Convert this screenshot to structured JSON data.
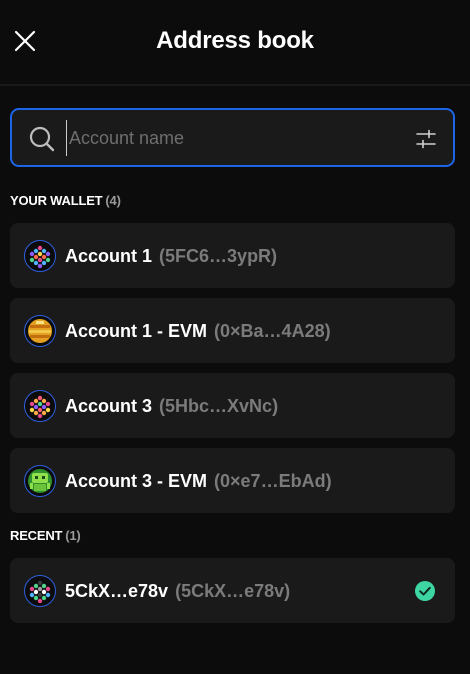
{
  "header": {
    "title": "Address book"
  },
  "search": {
    "placeholder": "Account name"
  },
  "wallet_section": {
    "label": "YOUR WALLET",
    "count": "(4)"
  },
  "recent_section": {
    "label": "RECENT",
    "count": "(1)"
  },
  "wallet_accounts": [
    {
      "name": "Account 1",
      "address": "(5FC6…3ypR)",
      "icon": "polkadot-identicon"
    },
    {
      "name": "Account 1 - EVM",
      "address": "(0×Ba…4A28)",
      "icon": "ethereum-avatar"
    },
    {
      "name": "Account 3",
      "address": "(5Hbc…XvNc)",
      "icon": "polkadot-identicon"
    },
    {
      "name": "Account 3 - EVM",
      "address": "(0×e7…EbAd)",
      "icon": "ethereum-avatar"
    }
  ],
  "recent_accounts": [
    {
      "name": "5CkX…e78v",
      "address": "(5CkX…e78v)",
      "icon": "polkadot-identicon",
      "selected": true
    }
  ],
  "colors": {
    "accent": "#1d64e6",
    "background": "#0c0c0c",
    "item_background": "#1a1a1a",
    "check": "#3dd6a3"
  }
}
